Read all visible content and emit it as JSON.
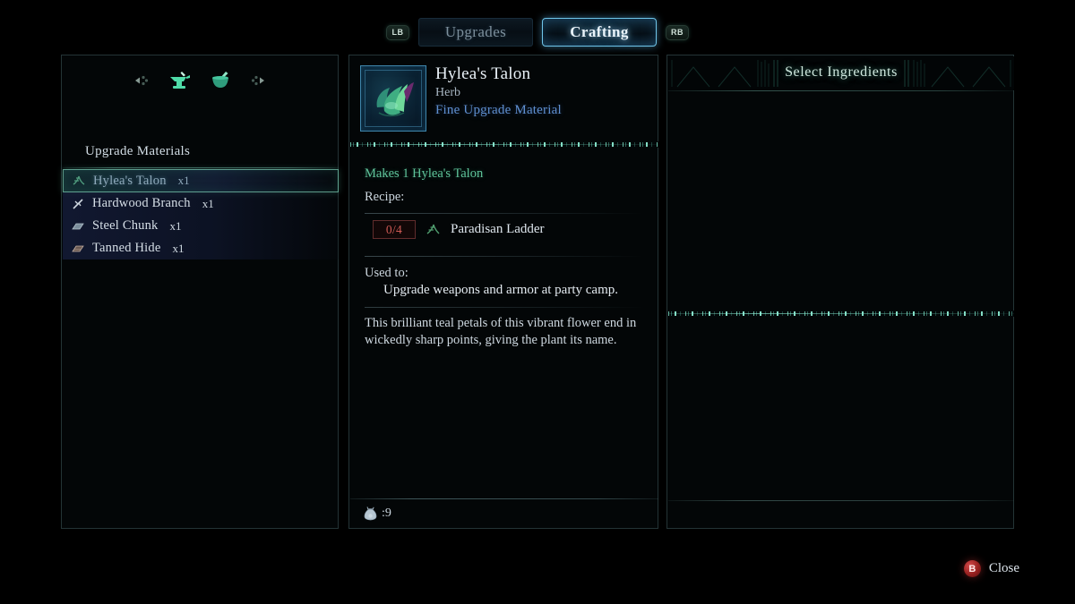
{
  "tabs": {
    "left_bumper": "LB",
    "right_bumper": "RB",
    "items": [
      {
        "label": "Upgrades",
        "active": false
      },
      {
        "label": "Crafting",
        "active": true
      }
    ]
  },
  "left_panel": {
    "category_icons": [
      "left-arrow-icon",
      "anvil-icon",
      "mortar-pestle-icon",
      "right-arrow-icon"
    ],
    "title": "Upgrade Materials",
    "materials": [
      {
        "icon": "herb-leaf-icon",
        "name": "Hylea's Talon",
        "qty": "x1",
        "selected": true
      },
      {
        "icon": "branch-icon",
        "name": "Hardwood Branch",
        "qty": "x1",
        "selected": false
      },
      {
        "icon": "metal-ingot-icon",
        "name": "Steel Chunk",
        "qty": "x1",
        "selected": false
      },
      {
        "icon": "leather-hide-icon",
        "name": "Tanned Hide",
        "qty": "x1",
        "selected": false
      }
    ]
  },
  "detail_panel": {
    "thumbnail_icon": "hyleas-talon-herb-icon",
    "item_name": "Hylea's Talon",
    "item_type": "Herb",
    "item_rarity": "Fine Upgrade Material",
    "makes_line": "Makes 1 Hylea's Talon",
    "recipe_label": "Recipe:",
    "recipe": [
      {
        "count": "0/4",
        "icon": "herb-leaf-icon",
        "name": "Paradisan Ladder"
      }
    ],
    "used_to_label": "Used to:",
    "used_to_text": "Upgrade weapons and armor at party camp.",
    "description": "This brilliant teal petals of this vibrant flower end in wickedly sharp points, giving the plant its name.",
    "footer": {
      "icon": "coin-pouch-icon",
      "value": ":9"
    }
  },
  "ingredients_panel": {
    "title": "Select Ingredients",
    "items": []
  },
  "footer_prompt": {
    "button_glyph": "B",
    "label": "Close"
  },
  "colors": {
    "accent_teal": "#6fc4e8",
    "rarity_blue": "#5f8fd0",
    "makes_green": "#5fc39a",
    "count_red": "#cf5a55",
    "panel_border": "#547476",
    "background": "#000000"
  }
}
